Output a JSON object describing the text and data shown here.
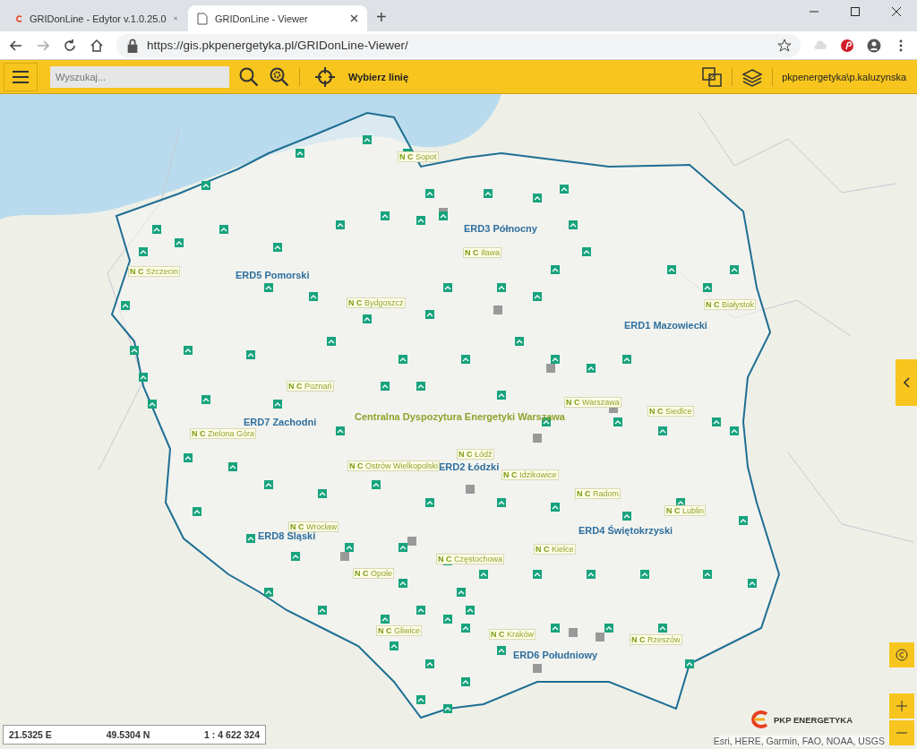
{
  "browser": {
    "tabs": [
      {
        "title": "GRIDonLine - Edytor v.1.0.25.0",
        "selected": false
      },
      {
        "title": "GRIDonLine - Viewer",
        "selected": true
      }
    ],
    "new_tab": "+",
    "url": "https://gis.pkpenergetyka.pl/GRIDonLine-Viewer/"
  },
  "toolbar": {
    "search": {
      "placeholder": "Wyszukaj..."
    },
    "pick_line": "Wybierz linię",
    "user": "pkpenergetyka\\p.kaluzynska"
  },
  "map": {
    "regions": [
      "ERD5 Pomorski",
      "ERD3 Północny",
      "ERD1 Mazowiecki",
      "Centralna Dyspozytura Energetyki Warszawa",
      "ERD7 Zachodni",
      "ERD2 Łódzki",
      "ERD4 Świętokrzyski",
      "ERD8 Śląski",
      "ERD6 Południowy"
    ],
    "stations": [
      {
        "code": "N C",
        "name": "Sopot"
      },
      {
        "code": "N C",
        "name": "Szczecin"
      },
      {
        "code": "N C",
        "name": "Bydgoszcz"
      },
      {
        "code": "N C",
        "name": "Iława"
      },
      {
        "code": "N C",
        "name": "Białystok"
      },
      {
        "code": "N C",
        "name": "Poznań"
      },
      {
        "code": "N C",
        "name": "Siedlce"
      },
      {
        "code": "N C",
        "name": "Warszawa"
      },
      {
        "code": "N C",
        "name": "Zielona Góra"
      },
      {
        "code": "N C",
        "name": "Ostrów Wielkopolski"
      },
      {
        "code": "N C",
        "name": "Łódź"
      },
      {
        "code": "N C",
        "name": "Idzikowice"
      },
      {
        "code": "N C",
        "name": "Radom"
      },
      {
        "code": "N C",
        "name": "Lublin"
      },
      {
        "code": "N C",
        "name": "Wrocław"
      },
      {
        "code": "N C",
        "name": "Kielce"
      },
      {
        "code": "N C",
        "name": "Częstochowa"
      },
      {
        "code": "N C",
        "name": "Opole"
      },
      {
        "code": "N C",
        "name": "Gliwice"
      },
      {
        "code": "N C",
        "name": "Kraków"
      },
      {
        "code": "N C",
        "name": "Rzeszów"
      }
    ],
    "coords": {
      "lon": "21.5325 E",
      "lat": "49.5304 N",
      "scale": "1 : 4 622 324"
    },
    "logo": "PKP ENERGETYKA",
    "attribution": "Esri, HERE, Garmin, FAO, NOAA, USGS"
  }
}
